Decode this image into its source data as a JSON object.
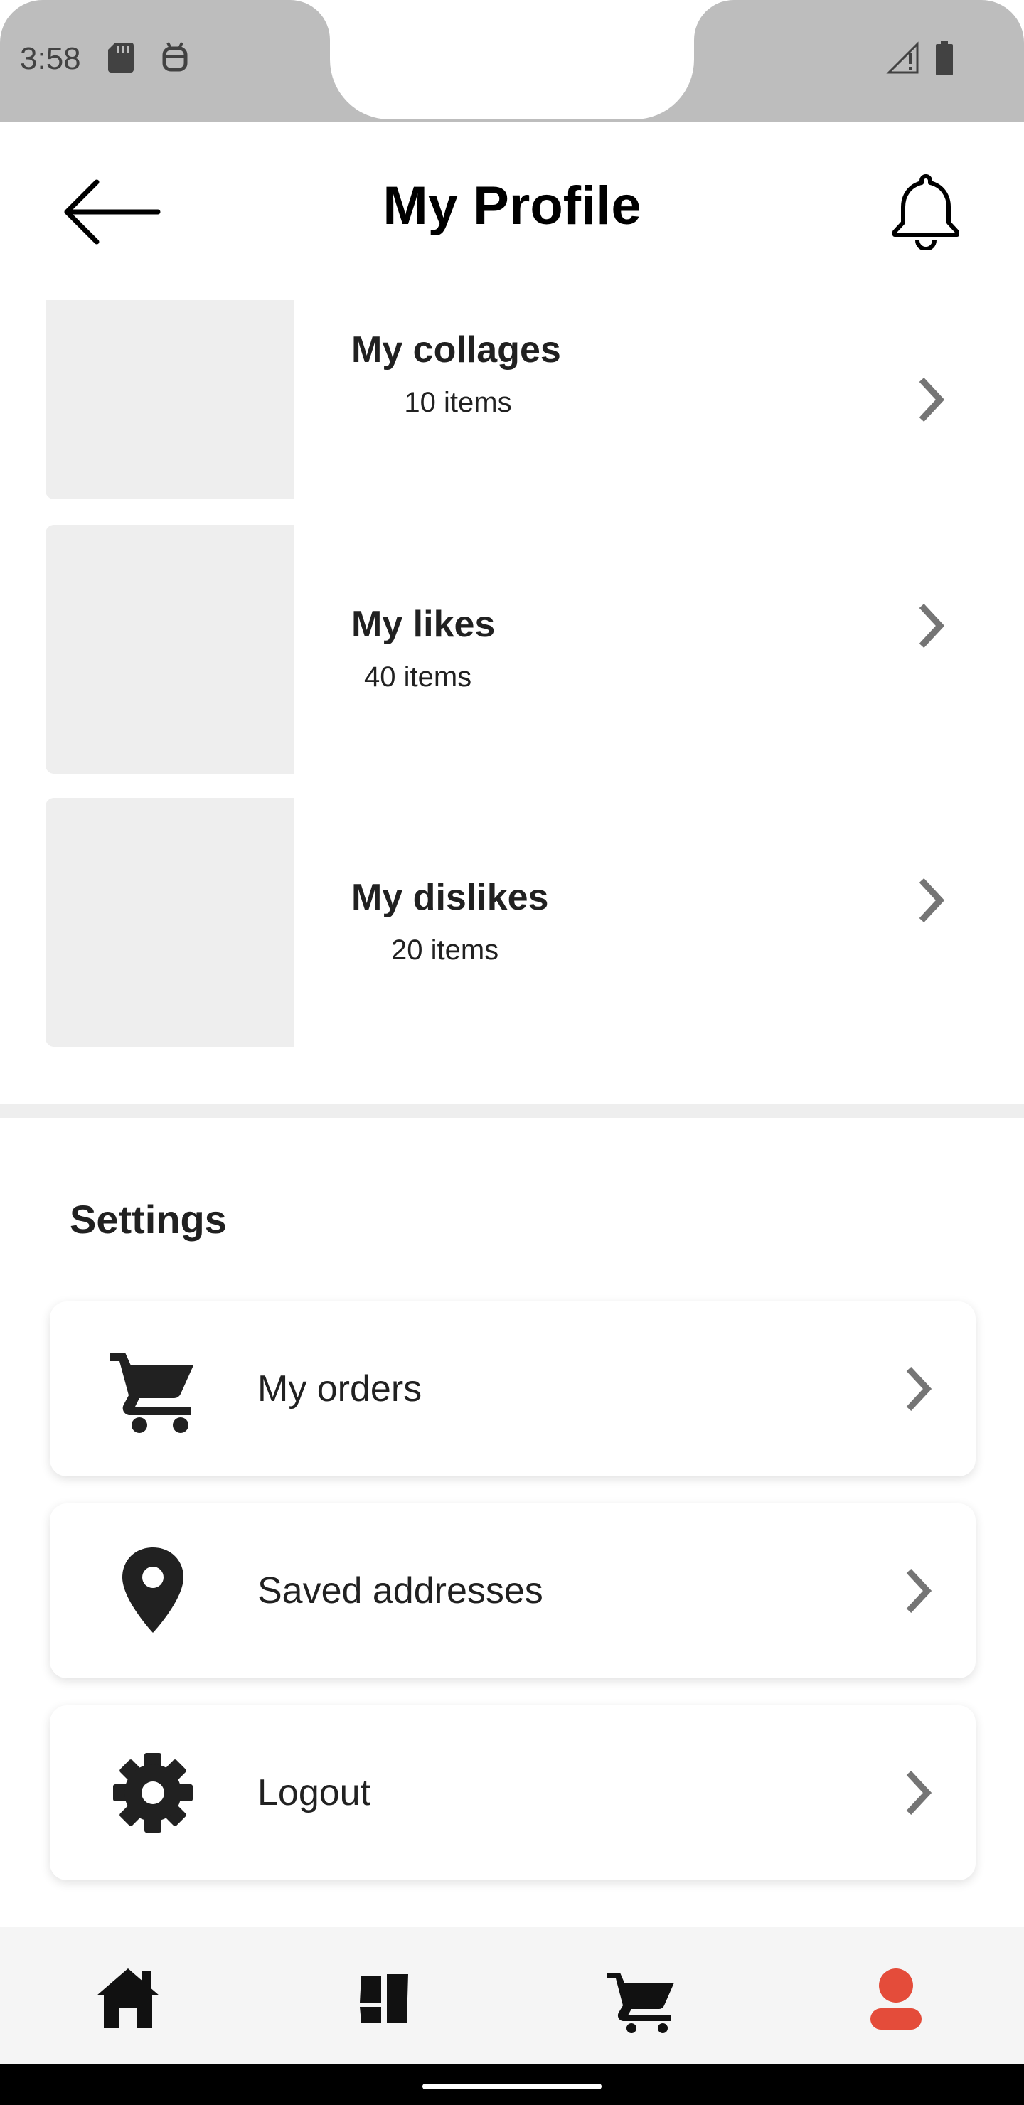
{
  "status_bar": {
    "time": "3:58",
    "icons_left": [
      "sd-card-icon",
      "android-icon"
    ],
    "icons_right": [
      "signal-icon",
      "battery-icon"
    ]
  },
  "header": {
    "title": "My Profile",
    "back_icon": "arrow-left-icon",
    "notification_icon": "bell-icon"
  },
  "collections": [
    {
      "title": "My collages",
      "count": "10 items"
    },
    {
      "title": "My likes",
      "count": "40 items"
    },
    {
      "title": "My dislikes",
      "count": "20 items"
    }
  ],
  "settings": {
    "title": "Settings",
    "items": [
      {
        "label": "My orders",
        "icon": "cart-icon"
      },
      {
        "label": "Saved addresses",
        "icon": "location-pin-icon"
      },
      {
        "label": "Logout",
        "icon": "gear-icon"
      }
    ]
  },
  "bottom_nav": {
    "items": [
      {
        "icon": "home-icon",
        "active": false
      },
      {
        "icon": "collage-icon",
        "active": false
      },
      {
        "icon": "cart-icon",
        "active": false
      },
      {
        "icon": "profile-icon",
        "active": true
      }
    ],
    "active_color": "#e44c3a",
    "inactive_color": "#111111"
  },
  "colors": {
    "accent": "#e44c3a",
    "thumbnail": "#eeeeee",
    "chevron": "#757575"
  }
}
